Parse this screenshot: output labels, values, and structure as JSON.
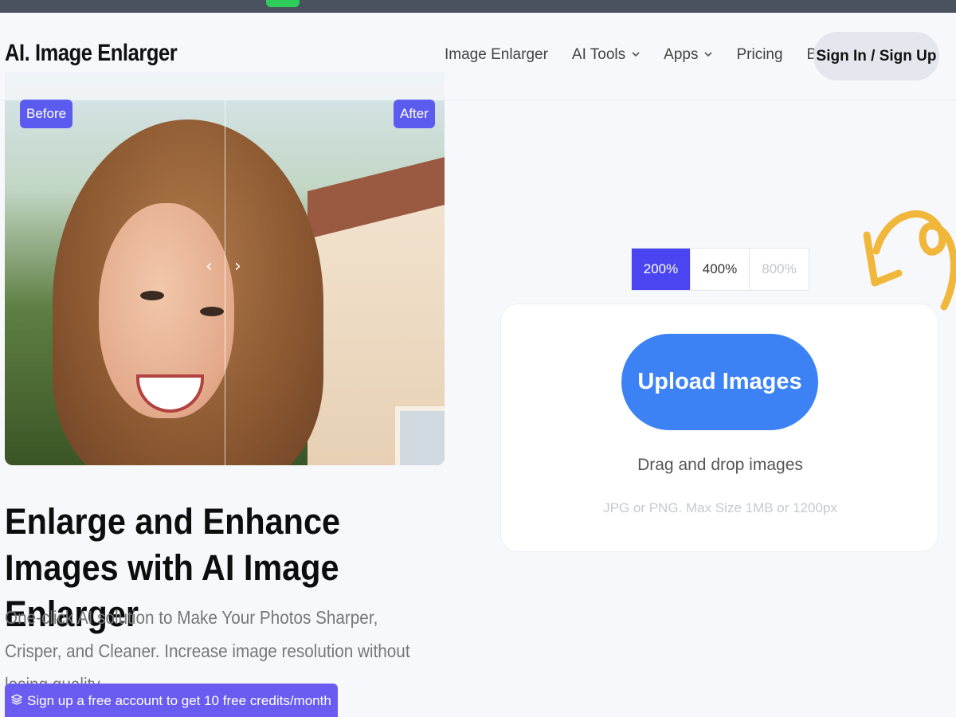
{
  "brand": {
    "logo": "AI. Image Enlarger"
  },
  "nav": {
    "items": [
      {
        "label": "Image Enlarger",
        "has_dropdown": false
      },
      {
        "label": "AI Tools",
        "has_dropdown": true
      },
      {
        "label": "Apps",
        "has_dropdown": true
      },
      {
        "label": "Pricing",
        "has_dropdown": false
      },
      {
        "label": "Blog",
        "has_dropdown": false
      }
    ],
    "dropdown_icon": "chevron-down-icon",
    "signin_label": "Sign In / Sign Up"
  },
  "comparison": {
    "before_label": "Before",
    "after_label": "After",
    "left_arrow": "‹",
    "right_arrow": "›"
  },
  "hero": {
    "headline": "Enlarge and Enhance Images with AI Image Enlarger",
    "subline": "One-click AI solution to Make Your Photos Sharper, Crisper, and Cleaner. Increase image resolution without losing quality.",
    "promo_icon": "layers-icon",
    "promo_label": "Sign up a free account to get 10 free credits/month"
  },
  "upload": {
    "scales": [
      {
        "label": "200%",
        "state": "active"
      },
      {
        "label": "400%",
        "state": "normal"
      },
      {
        "label": "800%",
        "state": "disabled"
      }
    ],
    "button_label": "Upload Images",
    "drag_text": "Drag and drop images",
    "hint_text": "JPG or PNG. Max Size 1MB or 1200px"
  },
  "colors": {
    "accent": "#4a45f0",
    "upload_button": "#3c82f5",
    "badge": "#5b5bf0",
    "arrow_doodle": "#f0b73a"
  }
}
